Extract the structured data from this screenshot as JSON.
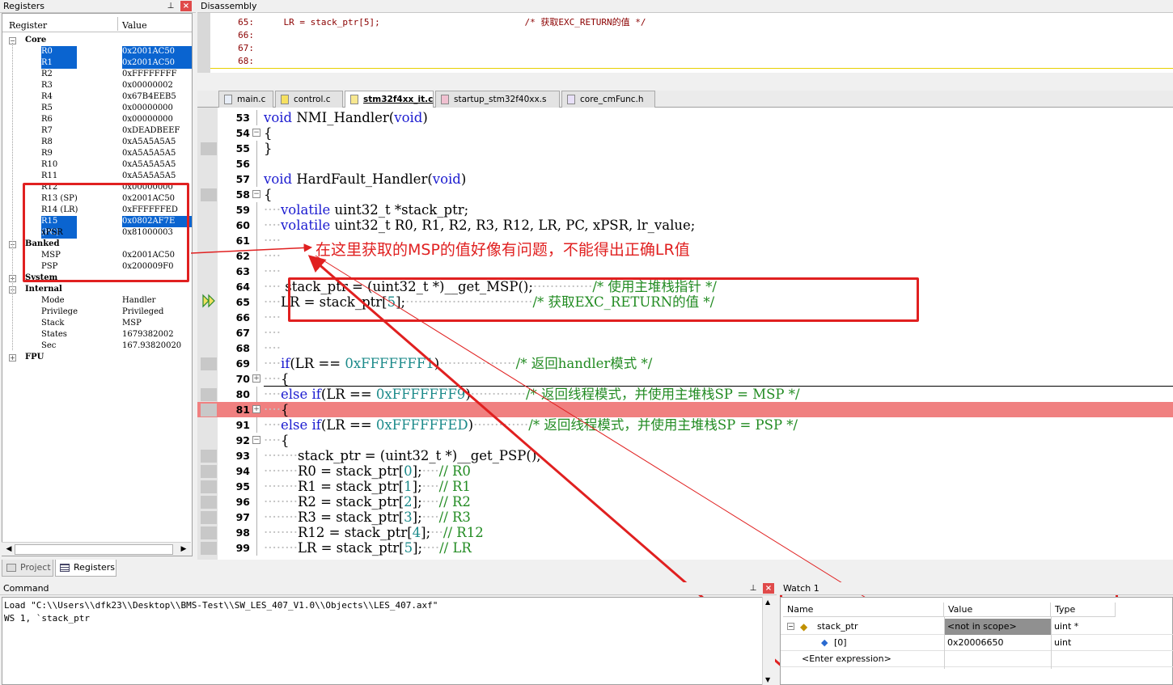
{
  "registers_panel": {
    "title": "Registers",
    "pin_icon": "pin-icon",
    "close_icon": "close-icon",
    "col_register": "Register",
    "col_value": "Value",
    "groups": {
      "core": "Core",
      "banked": "Banked",
      "system": "System",
      "internal": "Internal",
      "fpu": "FPU"
    },
    "core": [
      {
        "name": "R0",
        "value": "0x2001AC50",
        "selected": true
      },
      {
        "name": "R1",
        "value": "0x2001AC50",
        "selected": true
      },
      {
        "name": "R2",
        "value": "0xFFFFFFFF"
      },
      {
        "name": "R3",
        "value": "0x00000002"
      },
      {
        "name": "R4",
        "value": "0x67B4EEB5"
      },
      {
        "name": "R5",
        "value": "0x00000000"
      },
      {
        "name": "R6",
        "value": "0x00000000"
      },
      {
        "name": "R7",
        "value": "0xDEADBEEF"
      },
      {
        "name": "R8",
        "value": "0xA5A5A5A5"
      },
      {
        "name": "R9",
        "value": "0xA5A5A5A5"
      },
      {
        "name": "R10",
        "value": "0xA5A5A5A5"
      },
      {
        "name": "R11",
        "value": "0xA5A5A5A5"
      },
      {
        "name": "R12",
        "value": "0x00000000"
      },
      {
        "name": "R13 (SP)",
        "value": "0x2001AC50"
      },
      {
        "name": "R14 (LR)",
        "value": "0xFFFFFFED"
      },
      {
        "name": "R15 (PC)",
        "value": "0x0802AF7E",
        "selected": true
      },
      {
        "name": "xPSR",
        "value": "0x81000003"
      }
    ],
    "banked": [
      {
        "name": "MSP",
        "value": "0x2001AC50"
      },
      {
        "name": "PSP",
        "value": "0x200009F0"
      }
    ],
    "internal": [
      {
        "name": "Mode",
        "value": "Handler"
      },
      {
        "name": "Privilege",
        "value": "Privileged"
      },
      {
        "name": "Stack",
        "value": "MSP"
      },
      {
        "name": "States",
        "value": "1679382002"
      },
      {
        "name": "Sec",
        "value": "167.93820020"
      }
    ],
    "tabs": {
      "project": "Project",
      "registers": "Registers"
    }
  },
  "disassembly": {
    "title": "Disassembly",
    "lines": [
      {
        "num": "65:",
        "code": "    LR = stack_ptr[5];                           /* 获取EXC_RETURN的值 */"
      },
      {
        "num": "66:",
        "code": ""
      },
      {
        "num": "67:",
        "code": ""
      },
      {
        "num": "68:",
        "code": ""
      }
    ]
  },
  "file_tabs": [
    "main.c",
    "control.c",
    "stm32f4xx_it.c",
    "startup_stm32f40xx.s",
    "core_cmFunc.h"
  ],
  "editor": {
    "lines": [
      {
        "n": "53",
        "fold": "",
        "code": [
          [
            "kw",
            "void"
          ],
          [
            "",
            " NMI_Handler("
          ],
          [
            "kw",
            "void"
          ],
          [
            "",
            ")"
          ]
        ]
      },
      {
        "n": "54",
        "fold": "-",
        "code": [
          [
            "",
            "{"
          ]
        ]
      },
      {
        "n": "55",
        "fold": "",
        "code": [
          [
            "",
            "}"
          ]
        ]
      },
      {
        "n": "56",
        "fold": "",
        "code": []
      },
      {
        "n": "57",
        "fold": "",
        "code": [
          [
            "kw",
            "void"
          ],
          [
            "",
            " HardFault_Handler("
          ],
          [
            "kw",
            "void"
          ],
          [
            "",
            ")"
          ]
        ]
      },
      {
        "n": "58",
        "fold": "-",
        "code": [
          [
            "",
            "{"
          ]
        ]
      },
      {
        "n": "59",
        "fold": "",
        "code": [
          [
            "dots",
            "····"
          ],
          [
            "kw",
            "volatile"
          ],
          [
            "",
            " uint32_t *stack_ptr;"
          ]
        ]
      },
      {
        "n": "60",
        "fold": "",
        "code": [
          [
            "dots",
            "····"
          ],
          [
            "kw",
            "volatile"
          ],
          [
            "",
            " uint32_t R0, R1, R2, R3, R12, LR, PC, xPSR, lr_value;"
          ]
        ]
      },
      {
        "n": "61",
        "fold": "",
        "code": [
          [
            "dots",
            "····"
          ]
        ]
      },
      {
        "n": "62",
        "fold": "",
        "code": [
          [
            "dots",
            "····"
          ]
        ]
      },
      {
        "n": "63",
        "fold": "",
        "code": [
          [
            "dots",
            "····"
          ]
        ]
      },
      {
        "n": "64",
        "fold": "",
        "code": [
          [
            "dots",
            "····"
          ],
          [
            "",
            " stack_ptr = (uint32_t *)__get_MSP();"
          ],
          [
            "dots",
            "··············"
          ],
          [
            "cm",
            "/* 使用主堆栈指针 */"
          ]
        ]
      },
      {
        "n": "65",
        "fold": "",
        "code": [
          [
            "dots",
            "····"
          ],
          [
            "",
            "LR = stack_ptr["
          ],
          [
            "nm",
            "5"
          ],
          [
            "",
            "];"
          ],
          [
            "dots",
            "······························"
          ],
          [
            "cm",
            "/* 获取EXC_RETURN的值 */"
          ]
        ]
      },
      {
        "n": "66",
        "fold": "",
        "code": [
          [
            "dots",
            "····"
          ]
        ]
      },
      {
        "n": "67",
        "fold": "",
        "code": [
          [
            "dots",
            "····"
          ]
        ]
      },
      {
        "n": "68",
        "fold": "",
        "code": [
          [
            "dots",
            "····"
          ]
        ]
      },
      {
        "n": "69",
        "fold": "",
        "code": [
          [
            "dots",
            "····"
          ],
          [
            "kw",
            "if"
          ],
          [
            "",
            "(LR == "
          ],
          [
            "nm",
            "0xFFFFFFF1"
          ],
          [
            "",
            ")"
          ],
          [
            "dots",
            "··················"
          ],
          [
            "cm",
            "/* 返回handler模式 */"
          ]
        ]
      },
      {
        "n": "70",
        "fold": "+",
        "code": [
          [
            "dots",
            "····"
          ],
          [
            "",
            "{"
          ]
        ]
      },
      {
        "n": "80",
        "fold": "",
        "code": [
          [
            "dots",
            "····"
          ],
          [
            "kw",
            "else if"
          ],
          [
            "",
            "(LR == "
          ],
          [
            "nm",
            "0xFFFFFFF9"
          ],
          [
            "",
            ")"
          ],
          [
            "dots",
            "·············"
          ],
          [
            "cm",
            "/* 返回线程模式，并使用主堆栈SP = MSP */"
          ]
        ]
      },
      {
        "n": "81",
        "fold": "+",
        "hl": true,
        "code": [
          [
            "dots",
            "····"
          ],
          [
            "",
            "{"
          ]
        ]
      },
      {
        "n": "91",
        "fold": "",
        "code": [
          [
            "dots",
            "····"
          ],
          [
            "kw",
            "else if"
          ],
          [
            "",
            "(LR == "
          ],
          [
            "nm",
            "0xFFFFFFED"
          ],
          [
            "",
            ")"
          ],
          [
            "dots",
            "·············"
          ],
          [
            "cm",
            "/* 返回线程模式，并使用主堆栈SP = PSP */"
          ]
        ]
      },
      {
        "n": "92",
        "fold": "-",
        "code": [
          [
            "dots",
            "····"
          ],
          [
            "",
            "{"
          ]
        ]
      },
      {
        "n": "93",
        "fold": "",
        "code": [
          [
            "dots",
            "········"
          ],
          [
            "",
            "stack_ptr = (uint32_t *)__get_PSP();"
          ]
        ]
      },
      {
        "n": "94",
        "fold": "",
        "code": [
          [
            "dots",
            "········"
          ],
          [
            "",
            "R0 = stack_ptr["
          ],
          [
            "nm",
            "0"
          ],
          [
            "",
            "];"
          ],
          [
            "dots",
            "····"
          ],
          [
            "cm",
            "// R0"
          ]
        ]
      },
      {
        "n": "95",
        "fold": "",
        "code": [
          [
            "dots",
            "········"
          ],
          [
            "",
            "R1 = stack_ptr["
          ],
          [
            "nm",
            "1"
          ],
          [
            "",
            "];"
          ],
          [
            "dots",
            "····"
          ],
          [
            "cm",
            "// R1"
          ]
        ]
      },
      {
        "n": "96",
        "fold": "",
        "code": [
          [
            "dots",
            "········"
          ],
          [
            "",
            "R2 = stack_ptr["
          ],
          [
            "nm",
            "2"
          ],
          [
            "",
            "];"
          ],
          [
            "dots",
            "····"
          ],
          [
            "cm",
            "// R2"
          ]
        ]
      },
      {
        "n": "97",
        "fold": "",
        "code": [
          [
            "dots",
            "········"
          ],
          [
            "",
            "R3 = stack_ptr["
          ],
          [
            "nm",
            "3"
          ],
          [
            "",
            "];"
          ],
          [
            "dots",
            "····"
          ],
          [
            "cm",
            "// R3"
          ]
        ]
      },
      {
        "n": "98",
        "fold": "",
        "code": [
          [
            "dots",
            "········"
          ],
          [
            "",
            "R12 = stack_ptr["
          ],
          [
            "nm",
            "4"
          ],
          [
            "",
            "];"
          ],
          [
            "dots",
            "···"
          ],
          [
            "cm",
            "// R12"
          ]
        ]
      },
      {
        "n": "99",
        "fold": "",
        "code": [
          [
            "dots",
            "········"
          ],
          [
            "",
            "LR = stack_ptr["
          ],
          [
            "nm",
            "5"
          ],
          [
            "",
            "];"
          ],
          [
            "dots",
            "····"
          ],
          [
            "cm",
            "// LR"
          ]
        ]
      }
    ]
  },
  "annotation": "在这里获取的MSP的值好像有问题，不能得出正确LR值",
  "command": {
    "title": "Command",
    "lines": [
      "Load \"C:\\\\Users\\\\dfk23\\\\Desktop\\\\BMS-Test\\\\SW_LES_407_V1.0\\\\Objects\\\\LES_407.axf\"",
      "WS 1, `stack_ptr"
    ]
  },
  "watch": {
    "title": "Watch 1",
    "col_name": "Name",
    "col_value": "Value",
    "col_type": "Type",
    "rows": [
      {
        "name": "stack_ptr",
        "value": "<not in scope>",
        "type": "uint *"
      },
      {
        "name": "[0]",
        "value": "0x20006650",
        "type": "uint"
      },
      {
        "name": "<Enter expression>",
        "value": "",
        "type": ""
      }
    ]
  },
  "colors": {
    "accent_red": "#e02020",
    "selection_blue": "#0a64d0",
    "breakpoint_line": "#f08080"
  }
}
